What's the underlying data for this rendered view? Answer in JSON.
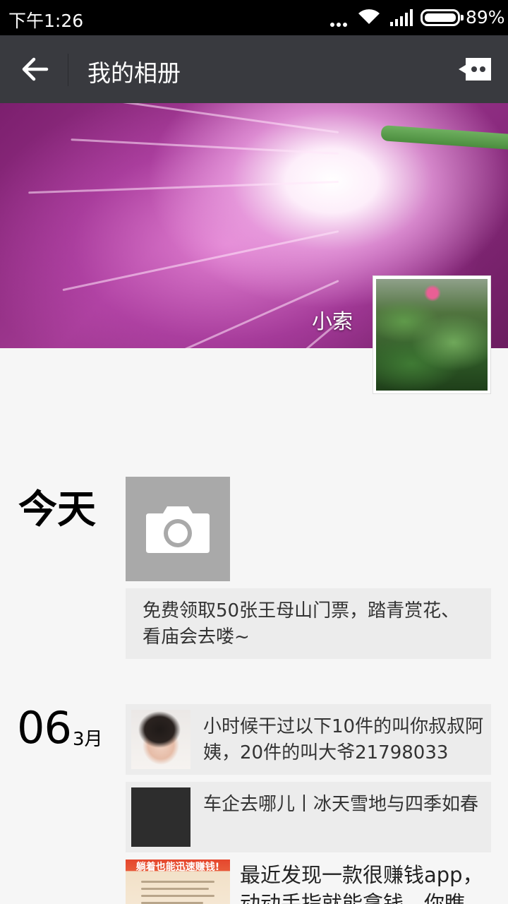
{
  "status_bar": {
    "time": "下午1:26",
    "battery_percent": "89%",
    "battery_level": 0.89,
    "icons": [
      "more-dots-icon",
      "wifi-icon",
      "signal-icon",
      "battery-icon"
    ]
  },
  "title_bar": {
    "back_icon": "arrow-left-icon",
    "title": "我的相册",
    "message_icon": "message-icon"
  },
  "profile": {
    "name": "小索"
  },
  "sections": {
    "today": {
      "date_label": "今天",
      "camera_icon": "camera-icon",
      "text_post": "免费领取50张王母山门票，踏青赏花、看庙会去喽~"
    },
    "march": {
      "day": "06",
      "month": "3月",
      "posts": [
        {
          "text": "小时候干过以下10件的叫你叔叔阿姨，20件的叫大爷21798033"
        },
        {
          "text": "车企去哪儿丨冰天雪地与四季如春"
        }
      ],
      "image_post": {
        "banner": "躺着也能迅速赚钱!",
        "text": "最近发现一款很赚钱app，动动手指就能拿钱，你瞧"
      }
    }
  },
  "colors": {
    "titlebar_bg": "#393a3f",
    "page_bg": "#f6f6f6",
    "post_bg": "#ececec",
    "camera_tile_bg": "#a9a9a9"
  }
}
